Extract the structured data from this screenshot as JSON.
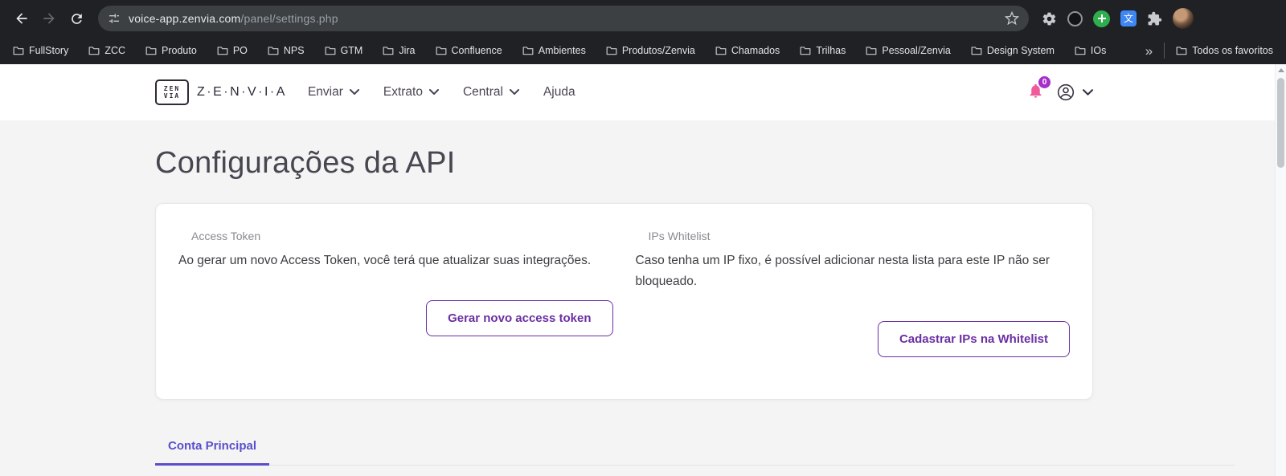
{
  "colors": {
    "accent": "#6a2fa2",
    "tab-accent": "#5a4fcb",
    "bell-pink": "#ef5b9c",
    "badge-bg": "#a62ecb",
    "chrome-bg": "#202124",
    "pill-bg": "#3c4043",
    "page-bg": "#f4f4f5",
    "header-text": "#4b4553",
    "title-color": "#474750"
  },
  "browser": {
    "url_host": "voice-app.zenvia.com",
    "url_path": "/panel/settings.php",
    "bookmarks": [
      "FullStory",
      "ZCC",
      "Produto",
      "PO",
      "NPS",
      "GTM",
      "Jira",
      "Confluence",
      "Ambientes",
      "Produtos/Zenvia",
      "Chamados",
      "Trilhas",
      "Pessoal/Zenvia",
      "Design System",
      "IOs"
    ],
    "overflow_chevron": "»",
    "all_bookmarks_label": "Todos os favoritos"
  },
  "header": {
    "logo_top": "ZEN",
    "logo_bottom": "VIA",
    "brand": "Z·E·N·V·I·A",
    "nav": [
      {
        "label": "Enviar"
      },
      {
        "label": "Extrato"
      },
      {
        "label": "Central"
      },
      {
        "label": "Ajuda"
      }
    ],
    "notification_count": "0"
  },
  "page": {
    "title": "Configurações da API",
    "card": {
      "access_token": {
        "label": "Access Token",
        "description": "Ao gerar um novo Access Token, você terá que atualizar suas integrações.",
        "button_label": "Gerar novo access token"
      },
      "ips_whitelist": {
        "label": "IPs Whitelist",
        "description": "Caso tenha um IP fixo, é possível adicionar nesta lista para este IP não ser bloqueado.",
        "button_label": "Cadastrar IPs na Whitelist"
      }
    },
    "active_tab": "Conta Principal"
  }
}
